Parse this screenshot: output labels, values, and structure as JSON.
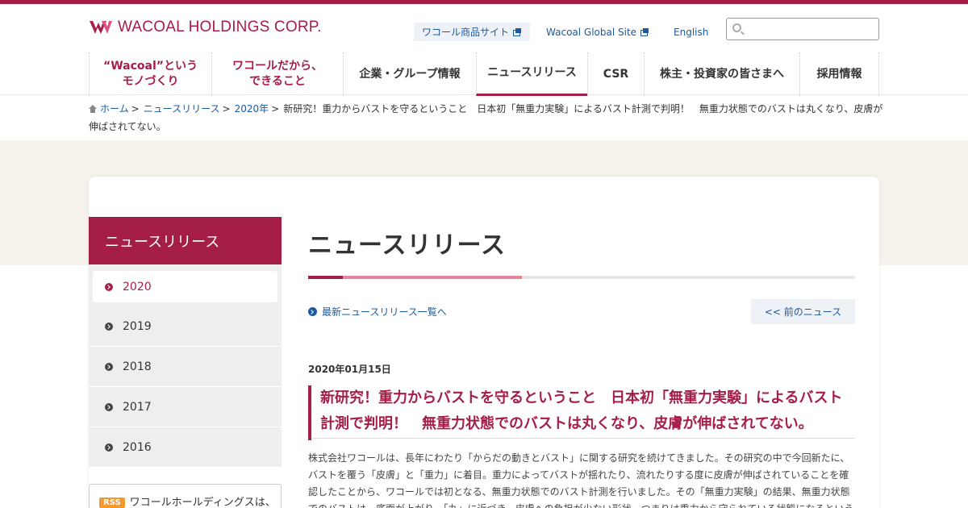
{
  "header": {
    "logo_text": "WACOAL HOLDINGS CORP.",
    "util_links": {
      "shop": "ワコール商品サイト",
      "global": "Wacoal Global Site",
      "english": "English"
    },
    "search": {
      "value": "",
      "placeholder": ""
    }
  },
  "nav": {
    "items": [
      {
        "label": "“Wacoal”という\nモノづくり",
        "style": "red"
      },
      {
        "label": "ワコールだから、\nできること",
        "style": "red"
      },
      {
        "label": "企業・グループ情報"
      },
      {
        "label": "ニュースリリース",
        "active": true
      },
      {
        "label": "CSR"
      },
      {
        "label": "株主・投資家の皆さまへ"
      },
      {
        "label": "採用情報"
      }
    ]
  },
  "breadcrumb": {
    "home": "ホーム",
    "news": "ニュースリリース",
    "year": "2020年",
    "current": "新研究！重力からバストを守るということ　日本初「無重力実験」によるバスト計測で判明！　無重力状態でのバストは丸くなり、皮膚が伸ばされてない。"
  },
  "sidebar": {
    "title": "ニュースリリース",
    "years": [
      "2020",
      "2019",
      "2018",
      "2017",
      "2016"
    ],
    "selected": "2020",
    "rss_badge": "RSS",
    "rss_text": "ワコールホールディングスは、"
  },
  "main": {
    "title": "ニュースリリース",
    "latest_link": "最新ニュースリリース一覧へ",
    "prev_button": "<< 前のニュース",
    "date": "2020年01月15日",
    "headline": "新研究！重力からバストを守るということ　日本初「無重力実験」によるバスト計測で判明！　無重力状態でのバストは丸くなり、皮膚が伸ばされてない。",
    "body": "株式会社ワコールは、長年にわたり「からだの動きとバスト」に関する研究を続けてきました。その研究の中で今回新たに、バストを覆う「皮膚」と「重力」に着目。重力によってバストが揺れたり、流れたりする度に皮膚が伸ばされていることを確認したことから、ワコールでは初となる、無重力状態でのバスト計測を行いました。その「無重力実験」の結果、無重力状態でのバストは、底面が上がり、「丸」に近づき、皮膚への負担が少ない形状、つまりは重力から守られている状態になるという"
  },
  "colors": {
    "brand": "#a51e48",
    "link": "#1a5aa0",
    "rss": "#f39a2e"
  }
}
